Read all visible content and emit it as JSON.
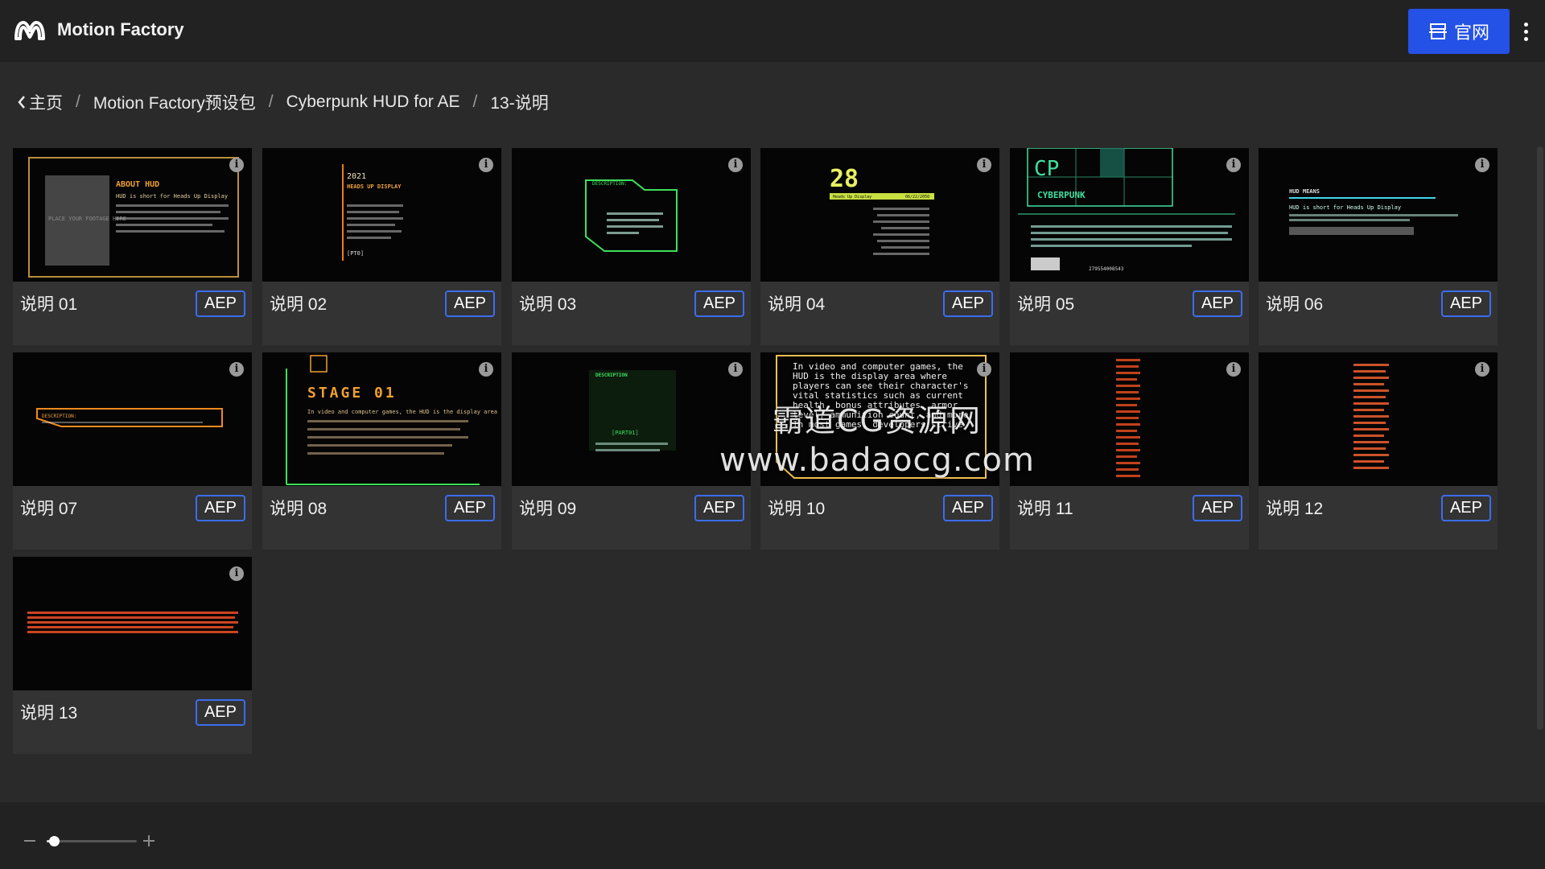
{
  "app": {
    "title": "Motion Factory",
    "official_label": "官网"
  },
  "breadcrumb": [
    {
      "label": "主页"
    },
    {
      "label": "Motion Factory预设包"
    },
    {
      "label": "Cyberpunk HUD for AE"
    },
    {
      "label": "13-说明"
    }
  ],
  "separator": "/",
  "cards": [
    {
      "name": "说明 01",
      "badge": "AEP",
      "thumb_text": [
        "ABOUT HUD",
        "HUD is short for Heads Up Display",
        "PLACE YOUR FOOTAGE HERE"
      ],
      "accent": "#e8b04a"
    },
    {
      "name": "说明 02",
      "badge": "AEP",
      "thumb_text": [
        "2021",
        "HEADS UP DISPLAY",
        "[PT0]"
      ],
      "accent": "#f07a1a"
    },
    {
      "name": "说明 03",
      "badge": "AEP",
      "thumb_text": [
        "DESCRIPTION:"
      ],
      "accent": "#3ee05a"
    },
    {
      "name": "说明 04",
      "badge": "AEP",
      "thumb_text": [
        "28",
        "Heads Up Display",
        "06/22/2050"
      ],
      "accent": "#d9e24a"
    },
    {
      "name": "说明 05",
      "badge": "AEP",
      "thumb_text": [
        "CP",
        "CYBERPUNK",
        "279554008543"
      ],
      "accent": "#3fe0a0"
    },
    {
      "name": "说明 06",
      "badge": "AEP",
      "thumb_text": [
        "HUD MEANS",
        "HUD is short for Heads Up Display"
      ],
      "accent": "#40d6e8"
    },
    {
      "name": "说明 07",
      "badge": "AEP",
      "thumb_text": [
        "DESCRIPTION:"
      ],
      "accent": "#f08a20"
    },
    {
      "name": "说明 08",
      "badge": "AEP",
      "thumb_text": [
        "STAGE 01",
        "In video and computer games, the HUD is the display area"
      ],
      "accent": "#f0a030"
    },
    {
      "name": "说明 09",
      "badge": "AEP",
      "thumb_text": [
        "DESCRIPTION",
        "[PART01]"
      ],
      "accent": "#3ee05a"
    },
    {
      "name": "说明 10",
      "badge": "AEP",
      "thumb_text": [
        "In video and computer games, the HUD is the display area where players can see their character's vital statistics such as current health, bonus attributes, armor level, ammunition count, and more. In most games, developers strive"
      ],
      "accent": "#f0c050"
    },
    {
      "name": "说明 11",
      "badge": "AEP",
      "thumb_text": [],
      "accent": "#f05020"
    },
    {
      "name": "说明 12",
      "badge": "AEP",
      "thumb_text": [],
      "accent": "#f06030"
    },
    {
      "name": "说明 13",
      "badge": "AEP",
      "thumb_text": [],
      "accent": "#f05028"
    }
  ],
  "watermark": {
    "line1": "霸道CG资源网",
    "line2": "www.badaocg.com"
  },
  "zoom": {
    "level": 0.08
  }
}
